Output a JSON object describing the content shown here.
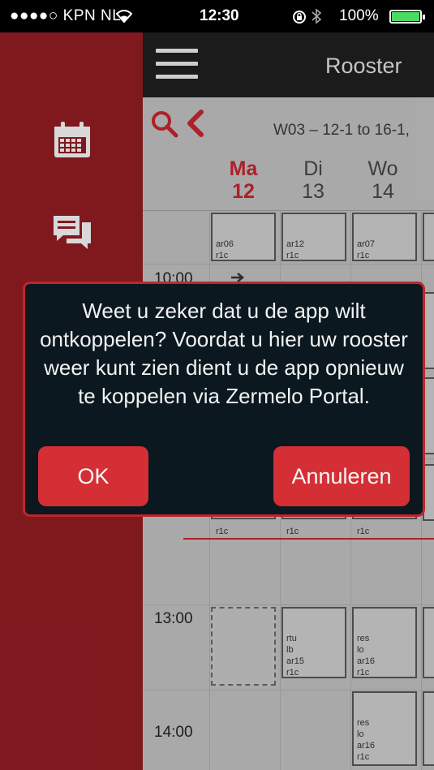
{
  "status_bar": {
    "carrier": "●●●●○ KPN NL",
    "time": "12:30",
    "battery": "100%",
    "icons": [
      "wifi-icon",
      "rotation-lock-icon",
      "bluetooth-icon",
      "battery-icon"
    ]
  },
  "sidebar": {
    "items": [
      {
        "icon": "calendar-icon"
      },
      {
        "icon": "messages-icon"
      }
    ]
  },
  "navbar": {
    "title": "Rooster"
  },
  "toolbar": {
    "week_label": "W03 – 12-1 to 16-1,"
  },
  "days": [
    {
      "name": "Ma",
      "date": "12",
      "active": true
    },
    {
      "name": "Di",
      "date": "13",
      "active": false
    },
    {
      "name": "Wo",
      "date": "14",
      "active": false
    }
  ],
  "times": [
    "10:00",
    "13:00",
    "14:00"
  ],
  "lessons": {
    "top_row": [
      {
        "text": "ar06\nr1c"
      },
      {
        "text": "ar12\nr1c"
      },
      {
        "text": "ar07\nr1c"
      }
    ],
    "mid_row": [
      {
        "text": "r1c"
      },
      {
        "text": "r1c"
      },
      {
        "text": "r1c"
      }
    ],
    "row_1300": [
      {
        "text": ""
      },
      {
        "text": "rtu\nlb\nar15\nr1c"
      },
      {
        "text": "res\nlo\nar16\nr1c"
      }
    ],
    "row_1400": [
      {
        "text": "res\nlo\nar16\nr1c"
      }
    ]
  },
  "dialog": {
    "message": "Weet u zeker dat u de app wilt ontkoppelen? Voordat u hier uw rooster weer kunt zien dient u de app opnieuw te koppelen via Zermelo Portal.",
    "ok_label": "OK",
    "cancel_label": "Annuleren"
  },
  "colors": {
    "accent": "#c1252c",
    "sidebar": "#8e1c22",
    "navbar": "#1f1f1f",
    "dialog_bg": "#0b1820"
  }
}
